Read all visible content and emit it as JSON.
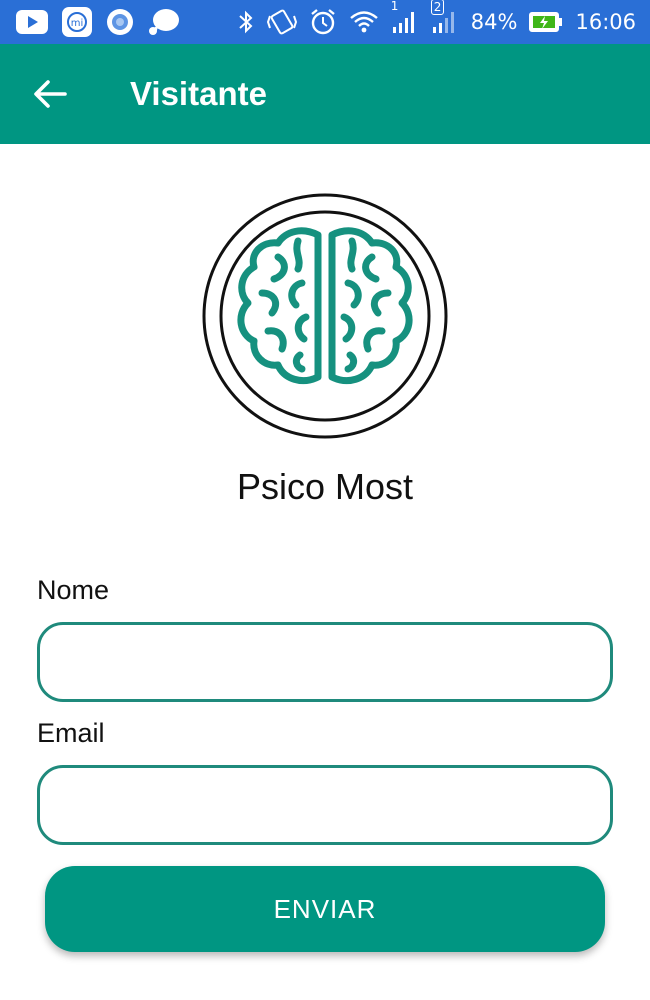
{
  "status_bar": {
    "battery_percent": "84%",
    "time": "16:06",
    "sim1_label": "1",
    "sim2_label": "2",
    "notification_icons": [
      "youtube-icon",
      "mi-icon",
      "circle-app-icon",
      "chat-bubble-icon"
    ],
    "system_icons": [
      "bluetooth-icon",
      "vibrate-icon",
      "alarm-icon",
      "wifi-icon",
      "signal-sim1-icon",
      "signal-sim2-icon",
      "battery-charging-icon"
    ]
  },
  "app_bar": {
    "title": "Visitante",
    "back_icon": "arrow-left-icon"
  },
  "brand": {
    "name": "Psico Most",
    "logo_icon": "brain-icon"
  },
  "form": {
    "name_label": "Nome",
    "name_value": "",
    "email_label": "Email",
    "email_value": "",
    "submit_label": "ENVIAR"
  },
  "colors": {
    "status_bar": "#2a6fd6",
    "primary": "#009682",
    "input_border": "#1f8a7c"
  }
}
